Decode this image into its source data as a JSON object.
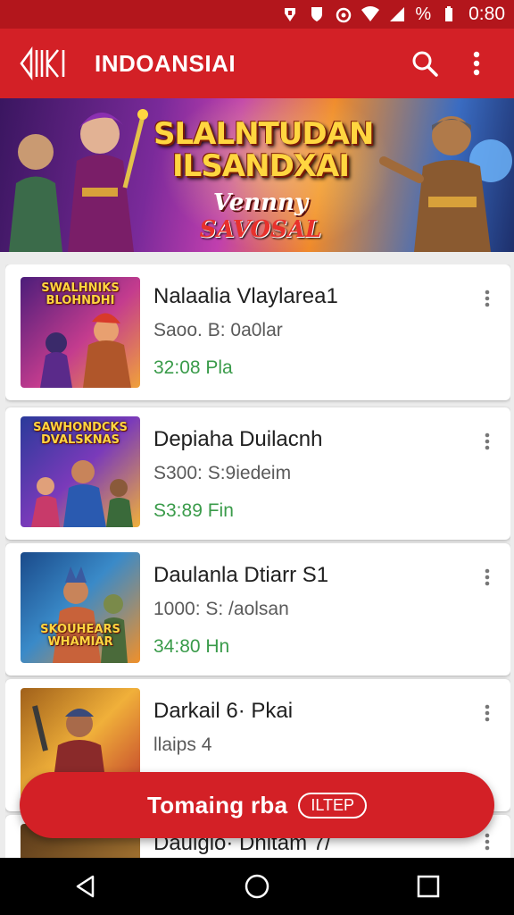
{
  "status_bar": {
    "time": "0:80",
    "battery_text": "%"
  },
  "app_bar": {
    "title": "INDOANSIAI"
  },
  "banner": {
    "title": "SLALNTUDAN ILSANDXAI",
    "subtitle_a": "Vennny",
    "subtitle_b": "SAVOSAL"
  },
  "items": [
    {
      "name": "Nalaalia Vlaylarea1",
      "sub": "Saoo. B: 0a0lar",
      "price": "32:08 Pla",
      "thumb_title": "SWALHNIKS BLOHNDHI"
    },
    {
      "name": "Depiaha Duilacnh",
      "sub": "S300: S:9iedeim",
      "price": "S3:89 Fin",
      "thumb_title": "SAWHONDCKS DVALSKNAS"
    },
    {
      "name": "Daulanla Dtiarr S1",
      "sub": "1000: S: /aolsan",
      "price": "34:80 Hn",
      "thumb_title": "SKOUHEARS WHAMIAR"
    },
    {
      "name": "Darkail 6· Pkai",
      "sub": "llaips 4",
      "price": "",
      "thumb_title": ""
    },
    {
      "name": "Daulglo· Dhltam 7/",
      "sub": "",
      "price": "",
      "thumb_title": ""
    }
  ],
  "fab": {
    "label": "Tomaing rba",
    "chip": "ILTEP"
  },
  "colors": {
    "primary": "#d32026",
    "status": "#b3161c",
    "price": "#3a9b4a"
  }
}
